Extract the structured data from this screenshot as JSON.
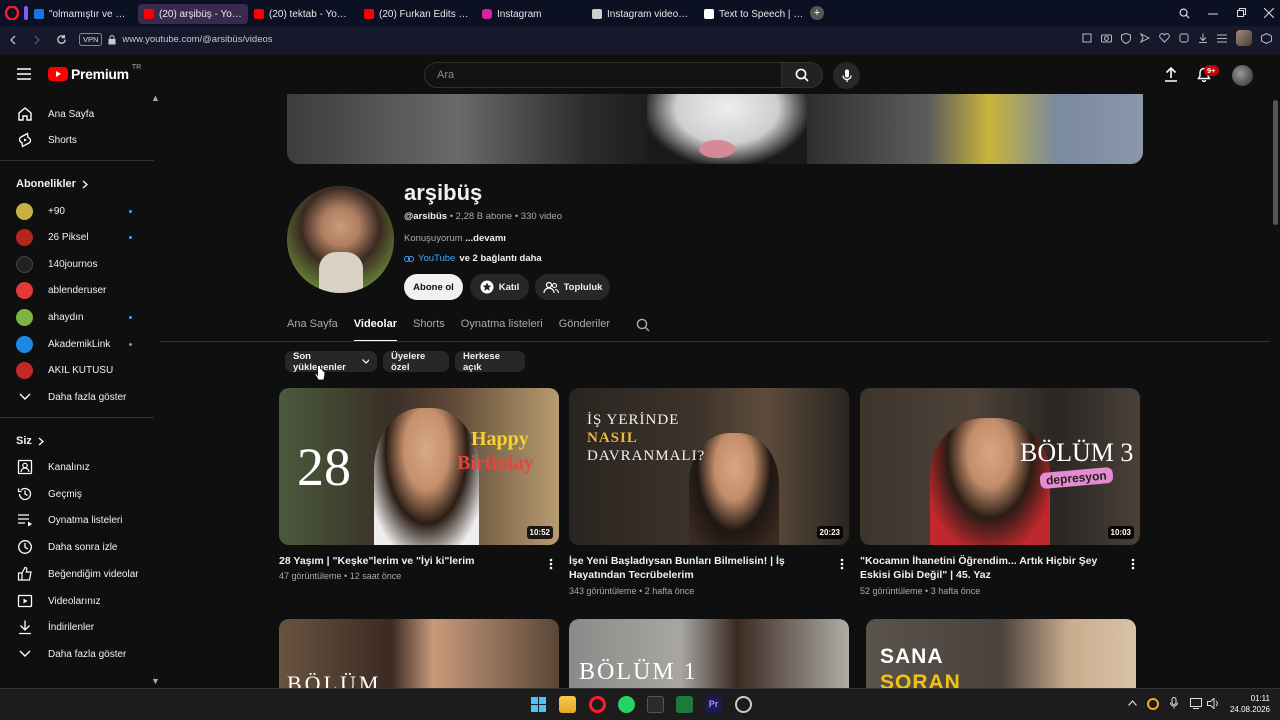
{
  "browser": {
    "tabs": [
      {
        "title": "\"olmamıştır ve muhtemelen",
        "fav_color": "#1a73e8"
      },
      {
        "title": "(20) arşibüş - YouTube",
        "fav_color": "#ff0000"
      },
      {
        "title": "(20) tektab - YouTube",
        "fav_color": "#ff0000"
      },
      {
        "title": "(20) Furkan Edits - YouTube",
        "fav_color": "#ff0000"
      },
      {
        "title": "Instagram",
        "fav_color": "#d6249f"
      },
      {
        "title": "Instagram videosu bulma",
        "fav_color": "#cfcfcf"
      },
      {
        "title": "Text to Speech | ElevenLabs",
        "fav_color": "#ffffff"
      }
    ],
    "vpn_label": "VPN",
    "url": "www.youtube.com/@arsibüs/videos"
  },
  "header": {
    "logo_text": "Premium",
    "logo_sup": "TR",
    "search_placeholder": "Ara",
    "notif_count": "9+"
  },
  "sidebar": {
    "main": [
      {
        "label": "Ana Sayfa",
        "icon": "home-icon"
      },
      {
        "label": "Shorts",
        "icon": "shorts-icon"
      }
    ],
    "subs_heading": "Abonelikler",
    "subs": [
      {
        "label": "+90",
        "color": "#c9b042",
        "dot": true
      },
      {
        "label": "26 Piksel",
        "color": "#b3261e",
        "dot": true
      },
      {
        "label": "140journos",
        "color": "#222222",
        "dot": false
      },
      {
        "label": "ablenderuser",
        "color": "#e53935",
        "dot": false
      },
      {
        "label": "ahaydın",
        "color": "#7cb342",
        "dot": true
      },
      {
        "label": "AkademikLink",
        "color": "#1e88e5",
        "dot": true
      },
      {
        "label": "AKIL KUTUSU",
        "color": "#c62828",
        "dot": false
      }
    ],
    "subs_more": "Daha fazla göster",
    "you_heading": "Siz",
    "you": [
      {
        "label": "Kanalınız",
        "icon": "channel-icon"
      },
      {
        "label": "Geçmiş",
        "icon": "history-icon"
      },
      {
        "label": "Oynatma listeleri",
        "icon": "playlist-icon"
      },
      {
        "label": "Daha sonra izle",
        "icon": "watch-later-icon"
      },
      {
        "label": "Beğendiğim videolar",
        "icon": "like-icon"
      },
      {
        "label": "Videolarınız",
        "icon": "your-videos-icon"
      },
      {
        "label": "İndirilenler",
        "icon": "download-icon"
      }
    ],
    "you_more": "Daha fazla göster"
  },
  "channel": {
    "name": "arşibüş",
    "handle": "@arsibüs",
    "meta": " • 2,28 B abone • 330 video",
    "desc": "Konuşuyorum ",
    "desc_more": "...devamı",
    "link": "YouTube",
    "link_more": "ve 2 bağlantı daha",
    "subscribe": "Abone ol",
    "join": "Katıl",
    "community": "Topluluk"
  },
  "tabs": [
    "Ana Sayfa",
    "Videolar",
    "Shorts",
    "Oynatma listeleri",
    "Gönderiler"
  ],
  "chips": [
    "Son yüklenenler",
    "Üyelere özel",
    "Herkese açık"
  ],
  "videos": [
    {
      "title": "28 Yaşım | \"Keşke\"lerim ve \"İyi ki\"lerim",
      "views": "47 görüntüleme",
      "age": "12 saat önce",
      "duration": "10:52",
      "overlay": "28",
      "overlay2": "Happy",
      "overlay3": "Birthday"
    },
    {
      "title": "İşe Yeni Başladıysan Bunları Bilmelisin! | İş Hayatından Tecrübelerim",
      "views": "343 görüntüleme",
      "age": "2 hafta önce",
      "duration": "20:23",
      "overlay": "İŞ YERİNDE",
      "overlay2": "NASIL",
      "overlay3": "DAVRANMALI?"
    },
    {
      "title": "\"Kocamın İhanetini Öğrendim... Artık Hiçbir Şey Eskisi Gibi Değil\" | 45. Yaz",
      "views": "52 görüntüleme",
      "age": "3 hafta önce",
      "duration": "10:03",
      "overlay": "BÖLÜM 3",
      "overlay2": "depresyon"
    }
  ],
  "row2_overlays": [
    "BÖLÜM",
    "BÖLÜM 1",
    "SANA",
    "SORAN"
  ],
  "taskbar": {
    "time": "01:11",
    "date": "24.08.2026"
  }
}
